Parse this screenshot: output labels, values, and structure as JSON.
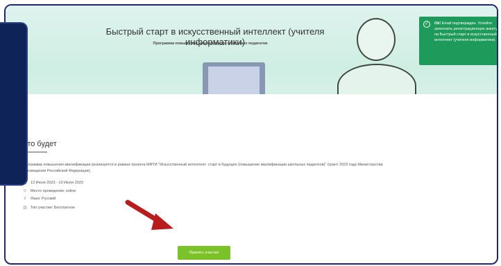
{
  "hero": {
    "title": "Быстрый старт в искусственный интеллект (учителя информатики)",
    "subtitle": "Программа повышения квалификации школьных педагогов"
  },
  "toast": {
    "strong": "Ok!",
    "text": "Email подтвержден. Успейте заполнить регистрационную анкету на Быстрый старт в искусственный интеллект (учителя информатики)."
  },
  "section": {
    "title": "Что будет",
    "description": "Программа повышения квалификации реализуется в рамках проекта МФТИ \"Искусственный интеллект: старт в будущее (повышение квалификации школьных педагогов)\" (грант 2023 года Министерства просвещения Российской Федерации)."
  },
  "details": {
    "dates": "13 Июня 2023 - 10 Июля 2023",
    "place": "Место проведения: online",
    "language": "Язык: Русский",
    "participation": "Тип участия: Бесплатное"
  },
  "cta": {
    "label": "Принять участие"
  },
  "colors": {
    "accent": "#7bc229",
    "toast": "#1e9a5a",
    "arrow": "#b81d1d"
  }
}
